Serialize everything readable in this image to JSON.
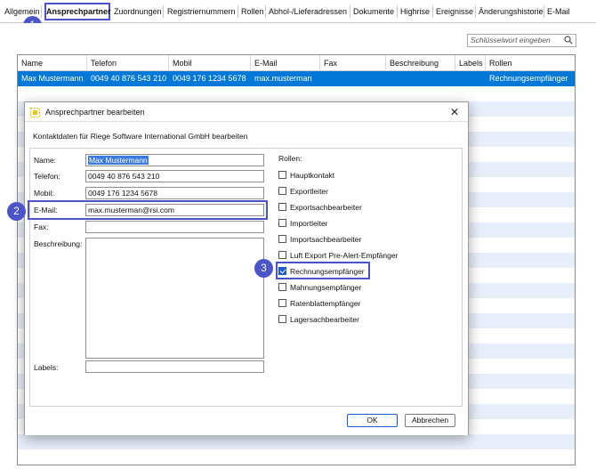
{
  "tabs": {
    "items": [
      "Allgemein",
      "Ansprechpartner",
      "Zuordnungen",
      "Registriernummern",
      "Rollen",
      "Abhol-/Lieferadressen",
      "Dokumente",
      "Highrise",
      "Ereignisse",
      "Änderungshistorie",
      "E-Mail"
    ],
    "active": "Ansprechpartner"
  },
  "badges": [
    "1",
    "2",
    "3"
  ],
  "search": {
    "placeholder": "Schlüsselwort eingeben",
    "icon": "search-icon"
  },
  "table": {
    "columns": [
      "Name",
      "Telefon",
      "Mobil",
      "E-Mail",
      "Fax",
      "Beschreibung",
      "Labels",
      "Rollen"
    ],
    "rows": [
      {
        "name": "Max Mustermann",
        "telefon": "0049 40 876 543 210",
        "mobil": "0049 176 1234 5678",
        "email": "max.musterman",
        "fax": "",
        "beschreibung": "",
        "labels": "",
        "rollen": "Rechnungsempfänger"
      }
    ]
  },
  "dialog": {
    "title": "Ansprechpartner bearbeiten",
    "subtitle": "Kontaktdaten für Riege Software International GmbH bearbeiten",
    "close_icon": "close-icon",
    "fields": {
      "name": {
        "label": "Name:",
        "value": "Max Mustermann"
      },
      "telefon": {
        "label": "Telefon:",
        "value": "0049 40 876 543 210"
      },
      "mobil": {
        "label": "Mobil:",
        "value": "0049 176 1234 5678"
      },
      "email": {
        "label": "E-Mail:",
        "value": "max.musterman@rsi.com"
      },
      "fax": {
        "label": "Fax:",
        "value": ""
      },
      "beschreibung": {
        "label": "Beschreibung:",
        "value": ""
      },
      "labels": {
        "label": "Labels:",
        "value": ""
      }
    },
    "roles": {
      "title": "Rollen:",
      "items": [
        {
          "label": "Hauptkontakt",
          "checked": false
        },
        {
          "label": "Exportleiter",
          "checked": false
        },
        {
          "label": "Exportsachbearbeiter",
          "checked": false
        },
        {
          "label": "Importleiter",
          "checked": false
        },
        {
          "label": "Importsachbearbeiter",
          "checked": false
        },
        {
          "label": "Luft Export Pre-Alert-Empfänger",
          "checked": false
        },
        {
          "label": "Rechnungsempfänger",
          "checked": true
        },
        {
          "label": "Mahnungsempfänger",
          "checked": false
        },
        {
          "label": "Ratenblattempfänger",
          "checked": false
        },
        {
          "label": "Lagersachbearbeiter",
          "checked": false
        }
      ]
    },
    "buttons": {
      "ok": "OK",
      "cancel": "Abbrechen"
    }
  },
  "colors": {
    "highlight": "#4b52c9",
    "selection": "#0078d7",
    "stripe": "#e8eefa",
    "checkbox": "#1a5fc7"
  }
}
